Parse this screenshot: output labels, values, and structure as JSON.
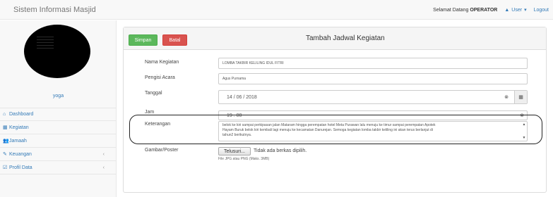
{
  "app": {
    "title": "Sistem Informasi Masjid",
    "welcome_prefix": "Selamat Datang ",
    "welcome_user": "OPERATOR",
    "user_menu": "User",
    "logout": "Logout"
  },
  "sidebar": {
    "username": "yoga",
    "items": [
      {
        "label": "Dashboard",
        "icon": "home-icon",
        "glyph": "⌂"
      },
      {
        "label": "Kegiatan",
        "icon": "calendar-icon",
        "glyph": "▦"
      },
      {
        "label": "Jamaah",
        "icon": "users-icon",
        "glyph": "👥"
      },
      {
        "label": "Keuangan",
        "icon": "pencil-icon",
        "glyph": "✎"
      },
      {
        "label": "Profil Data",
        "icon": "edit-icon",
        "glyph": "☑"
      }
    ]
  },
  "panel": {
    "simpan": "Simpan",
    "batal": "Batal",
    "title": "Tambah Jadwal Kegiatan"
  },
  "form": {
    "nama_kegiatan": {
      "label": "Nama Kegiatan",
      "value": "LOMBA TAKBIR KELILING IDUL FITRI"
    },
    "pengisi_acara": {
      "label": "Pengisi Acara",
      "value": "Agus Purnama"
    },
    "tanggal": {
      "label": "Tanggal",
      "value": "14 / 06 / 2018"
    },
    "jam": {
      "label": "Jam",
      "value": "19 . 00"
    },
    "keterangan": {
      "label": "Keterangan",
      "line1": "belok ke kiri sampai perkipasan jalan Mataram hingga perempatan hotel Meta Purawan lalu menuju ke timur sampai perempatan Apotek",
      "line2": "Hayam Buruk belok kiri kembali lagi menuju ke kecamatan Danurejan. Semoga kegiatan lomba takbir keliling ini akan terus berlanjut di",
      "line3": "tahun2 berikutnya."
    },
    "gambar": {
      "label": "Gambar/Poster",
      "button": "Telusuri...",
      "status": "Tidak ada berkas dipilih.",
      "hint": "File JPG atau PNG (Maks. 3MB)"
    }
  },
  "colors": {
    "link": "#337ab7",
    "success": "#5cb85c",
    "danger": "#d9534f"
  }
}
